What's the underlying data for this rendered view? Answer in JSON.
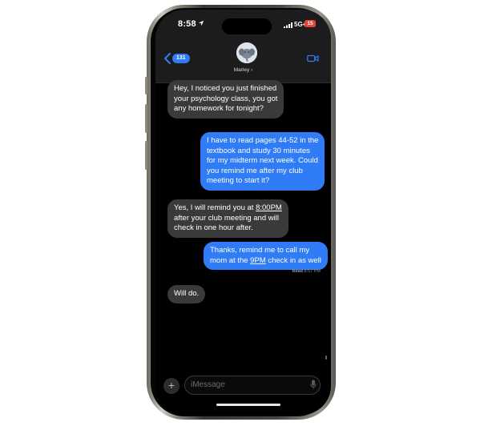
{
  "status_bar": {
    "time": "8:58",
    "network": "5G+",
    "battery": "15"
  },
  "header": {
    "back_count": "131",
    "contact_name": "Marley ›"
  },
  "messages": [
    {
      "lines": [
        "Hey, I noticed you just finished",
        "your psychology class, you got",
        "any homework for tonight?"
      ]
    },
    {
      "lines": [
        "I have to read pages 44-52 in the",
        "textbook and study 30 minutes",
        "for my midterm next week. Could",
        "you remind me after my club",
        "meeting to start it?"
      ]
    },
    {
      "l1_pre": "Yes, I will remind you at ",
      "l1_link": "8:00PM",
      "l2": "after your club meeting and will",
      "l3": "check in one hour after."
    },
    {
      "l1": "Thanks, remind me to call my",
      "l2_pre": "mom at the ",
      "l2_link": "9PM",
      "l2_post": " check in as well"
    },
    {
      "lines": [
        "Will do."
      ]
    }
  ],
  "read_receipt": {
    "label": "Read",
    "time": "8:57 PM"
  },
  "input": {
    "placeholder": "iMessage",
    "plus_label": "+"
  },
  "icons": {
    "location": "location-arrow-icon",
    "signal": "cellular-signal-icon",
    "back": "chevron-left-icon",
    "avatar": "elephant-avatar-icon",
    "video": "video-camera-icon",
    "mic": "microphone-icon"
  },
  "colors": {
    "outgoing_bubble": "#2f7cf6",
    "incoming_bubble": "#3a3a3c",
    "background": "#000000",
    "battery_badge": "#e0443a"
  }
}
